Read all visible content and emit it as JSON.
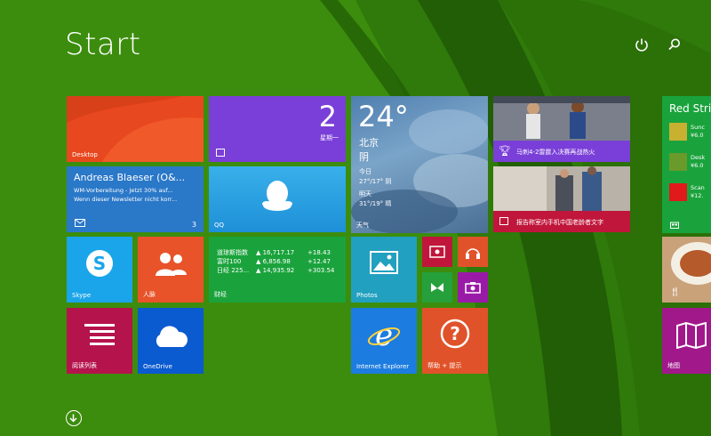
{
  "screen": {
    "title": "Start"
  },
  "colors": {
    "background": "#3c8d0d",
    "desktop": "#e8481f",
    "calendar": "#7a3fd8",
    "mail": "#2a78c8",
    "qq": "#2aa0e0",
    "finance": "#1aa33c",
    "skype": "#1aa5ea",
    "people": "#e8532a",
    "readinglist": "#b5134b",
    "onedrive": "#0a5ad0",
    "photos": "#22a0bf",
    "video": "#c0163b",
    "music": "#e0532a",
    "games": "#25a03a",
    "camera": "#9a1aa8",
    "ie": "#1c7ce0",
    "help": "#e0532a",
    "store": "#1aa33c",
    "maps": "#a1188b"
  },
  "tiles": {
    "desktop": {
      "label": "Desktop"
    },
    "calendar": {
      "day": "2",
      "weekday": "星期一"
    },
    "weather": {
      "temp": "24°",
      "city": "北京",
      "condition": "阴",
      "today_label": "今日",
      "today_range": "27°/17° 阴",
      "tomorrow_label": "明天",
      "tomorrow_range": "31°/19° 晴",
      "label": "天气"
    },
    "sports": {
      "headline": "马刺4-2雷霆入决赛再战热火"
    },
    "news": {
      "headline": "报告称室内手机中国老龄者文字"
    },
    "mail": {
      "sender": "Andreas Blaeser (O&...",
      "line1": "WM-Vorbereitung - Jetzt 30% auf...",
      "line2": "Wenn dieser Newsletter nicht korr...",
      "count": "3"
    },
    "qq": {
      "label": "QQ"
    },
    "finance": {
      "label": "财经",
      "rows": [
        {
          "name": "道琼斯指数",
          "value": "▲ 16,717.17",
          "change": "+18.43"
        },
        {
          "name": "富时100",
          "value": "▲ 6,856.98",
          "change": "+12.47"
        },
        {
          "name": "日经 225...",
          "value": "▲ 14,935.92",
          "change": "+303.54"
        }
      ]
    },
    "skype": {
      "label": "Skype"
    },
    "people": {
      "label": "人脉"
    },
    "readinglist": {
      "label": "阅读列表"
    },
    "onedrive": {
      "label": "OneDrive"
    },
    "photos": {
      "label": "Photos"
    },
    "ie": {
      "label": "Internet Explorer"
    },
    "help": {
      "label": "帮助 + 提示"
    },
    "store": {
      "title": "Red Strin",
      "items": [
        {
          "name": "Sunc",
          "price": "¥6.0"
        },
        {
          "name": "Desk",
          "price": "¥6.0"
        },
        {
          "name": "Scan",
          "price": "¥12."
        }
      ]
    },
    "maps": {
      "label": "地图"
    }
  }
}
